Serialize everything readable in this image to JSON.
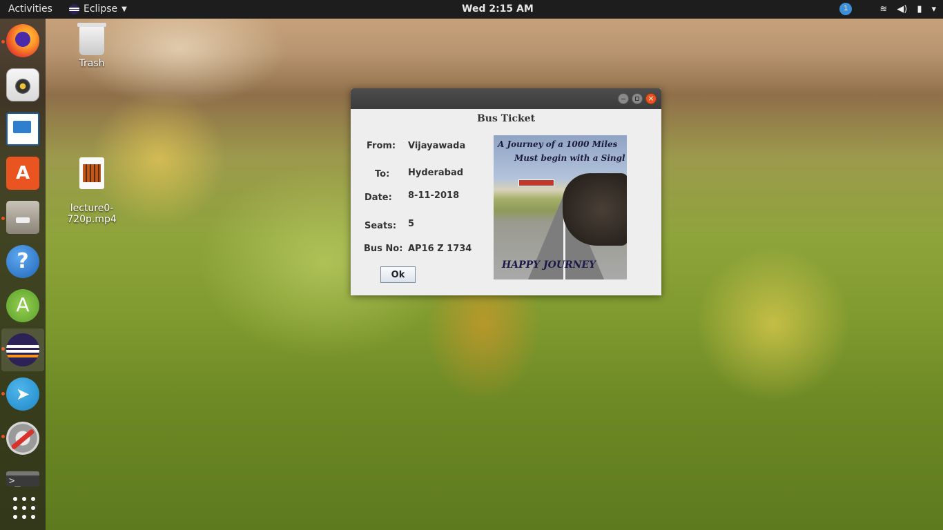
{
  "topbar": {
    "activities": "Activities",
    "app_name": "Eclipse",
    "clock": "Wed  2:15 AM",
    "update_count": "1",
    "icons": [
      "network-icon",
      "volume-icon",
      "battery-icon",
      "power-menu-icon"
    ]
  },
  "dock": {
    "items": [
      "firefox-icon",
      "rhythmbox-icon",
      "libreoffice-impress-icon",
      "software-center-icon",
      "files-icon",
      "help-icon",
      "android-studio-icon",
      "eclipse-icon",
      "telegram-icon",
      "settings-icon",
      "terminal-icon",
      "show-apps-icon"
    ]
  },
  "desktop": {
    "trash_label": "Trash",
    "video_label": "lecture0-\n720p.mp4"
  },
  "dialog": {
    "title": "Bus Ticket",
    "from_label": "From:",
    "from_value": "Vijayawada",
    "to_label": "To:",
    "to_value": "Hyderabad",
    "date_label": "Date:",
    "date_value": "8-11-2018",
    "seats_label": "Seats:",
    "seats_value": "5",
    "busno_label": "Bus No:",
    "busno_value": "AP16 Z 1734",
    "ok_label": "Ok",
    "poster": {
      "line1": "A  Journey of a 1000 Miles",
      "line2": "Must begin with a Singl",
      "line3": "HAPPY JOURNEY"
    }
  },
  "colors": {
    "accent": "#e95420",
    "topbar": "#1d1d1d",
    "dialog_bg": "#eeeeee"
  }
}
